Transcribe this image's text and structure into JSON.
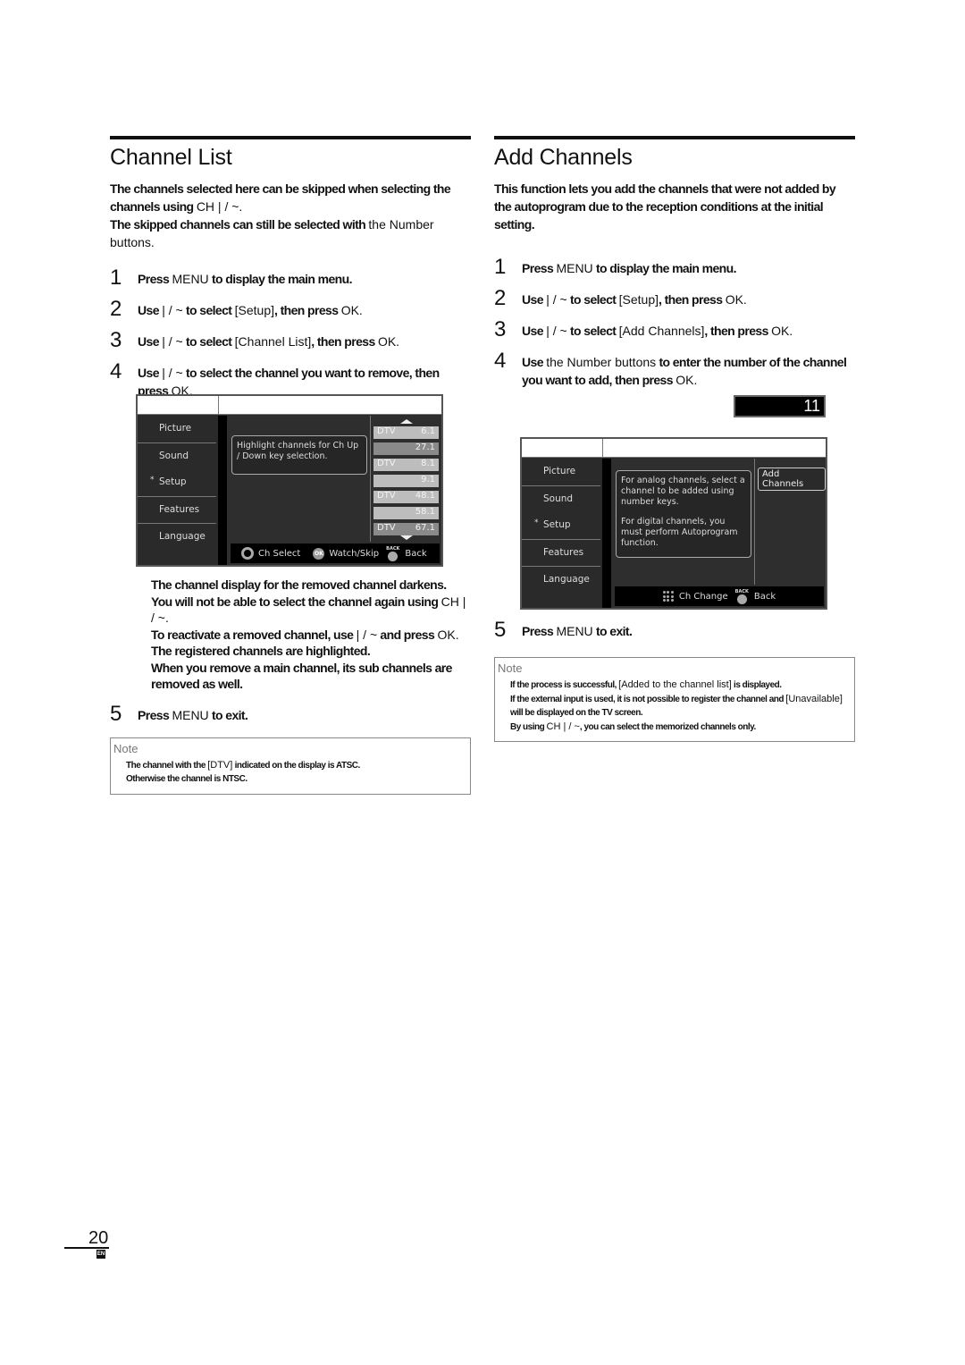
{
  "channel_list": {
    "title": "Channel List",
    "intro": [
      {
        "bold": "The channels selected here can be skipped when selecting the channels using ",
        "plain": "CH  | / ~."
      },
      {
        "bold": "The skipped channels can still be selected with ",
        "plain": "the Number buttons."
      }
    ],
    "steps": [
      {
        "num": "1",
        "parts": [
          {
            "b": "Press "
          },
          {
            "p": "MENU"
          },
          {
            "b": " to display the main menu."
          }
        ]
      },
      {
        "num": "2",
        "parts": [
          {
            "b": "Use  "
          },
          {
            "p": "| / ~"
          },
          {
            "b": " to select "
          },
          {
            "p": "[Setup]"
          },
          {
            "b": ", then press "
          },
          {
            "p": "OK."
          }
        ]
      },
      {
        "num": "3",
        "parts": [
          {
            "b": "Use  "
          },
          {
            "p": "| / ~"
          },
          {
            "b": " to select "
          },
          {
            "p": "[Channel List]"
          },
          {
            "b": ", then press "
          },
          {
            "p": "OK."
          }
        ]
      },
      {
        "num": "4",
        "parts": [
          {
            "b": "Use  "
          },
          {
            "p": "| / ~"
          },
          {
            "b": " to select the channel you want to remove, then press "
          },
          {
            "p": "OK."
          }
        ]
      }
    ],
    "osd": {
      "nav": [
        "Picture",
        "Sound",
        "Setup",
        "Features",
        "Language"
      ],
      "active_marker": "*",
      "message": "Highlight channels for Ch Up / Down key selection.",
      "channels": [
        {
          "type": "DTV",
          "number": "6.1",
          "shade": "light"
        },
        {
          "type": "",
          "number": "27.1",
          "shade": "dark"
        },
        {
          "type": "DTV",
          "number": "8.1",
          "shade": "light"
        },
        {
          "type": "",
          "number": "9.1",
          "shade": "light"
        },
        {
          "type": "DTV",
          "number": "48.1",
          "shade": "light"
        },
        {
          "type": "",
          "number": "58.1",
          "shade": "light"
        },
        {
          "type": "DTV",
          "number": "67.1",
          "shade": "dark"
        }
      ],
      "footer": {
        "select": "Ch Select",
        "ok_icon": "OK",
        "watch_skip": "Watch/Skip",
        "back_icon_label": "BACK",
        "back": "Back"
      }
    },
    "sub_notes": [
      {
        "parts": [
          {
            "b": "The channel display for the removed channel darkens."
          }
        ]
      },
      {
        "parts": [
          {
            "b": "You will not be able to select the channel again using "
          },
          {
            "p": "CH  | / ~."
          }
        ]
      },
      {
        "parts": [
          {
            "b": "To reactivate a removed channel, use  "
          },
          {
            "p": "| / ~"
          },
          {
            "b": " and press "
          },
          {
            "p": "OK."
          },
          {
            "b": " The registered channels are highlighted."
          }
        ]
      },
      {
        "parts": [
          {
            "b": "When you remove a main channel, its sub channels are removed as well."
          }
        ]
      }
    ],
    "step5": {
      "num": "5",
      "parts": [
        {
          "b": "Press "
        },
        {
          "p": "MENU"
        },
        {
          "b": " to exit."
        }
      ]
    },
    "note": {
      "title": "Note",
      "lines": [
        {
          "parts": [
            {
              "b": "The channel with the "
            },
            {
              "p": "[DTV]"
            },
            {
              "b": " indicated on the display is ATSC."
            }
          ]
        },
        {
          "parts": [
            {
              "b": "Otherwise the channel is NTSC."
            }
          ]
        }
      ]
    }
  },
  "add_channels": {
    "title": "Add Channels",
    "intro": [
      {
        "bold": "This function lets you add the channels that were not added by the autoprogram due to the reception conditions at the initial setting."
      }
    ],
    "steps": [
      {
        "num": "1",
        "parts": [
          {
            "b": "Press "
          },
          {
            "p": "MENU"
          },
          {
            "b": " to display the main menu."
          }
        ]
      },
      {
        "num": "2",
        "parts": [
          {
            "b": "Use  "
          },
          {
            "p": "| / ~"
          },
          {
            "b": " to select "
          },
          {
            "p": "[Setup]"
          },
          {
            "b": ", then press "
          },
          {
            "p": "OK."
          }
        ]
      },
      {
        "num": "3",
        "parts": [
          {
            "b": "Use  "
          },
          {
            "p": "| / ~"
          },
          {
            "b": " to select "
          },
          {
            "p": "[Add Channels]"
          },
          {
            "b": ", then press "
          },
          {
            "p": "OK."
          }
        ]
      },
      {
        "num": "4",
        "parts": [
          {
            "b": "Use "
          },
          {
            "p": "the Number buttons"
          },
          {
            "b": " to enter the number of the channel you want to add, then press "
          },
          {
            "p": "OK."
          }
        ]
      }
    ],
    "channel_display": "11",
    "osd": {
      "nav": [
        "Picture",
        "Sound",
        "Setup",
        "Features",
        "Language"
      ],
      "active_marker": "*",
      "message_1": "For analog channels, select a channel to be added using number keys.",
      "message_2": "For digital channels, you must perform Autoprogram function.",
      "button": "Add Channels",
      "footer": {
        "change": "Ch Change",
        "back_icon_label": "BACK",
        "back": "Back"
      }
    },
    "step5": {
      "num": "5",
      "parts": [
        {
          "b": "Press "
        },
        {
          "p": "MENU"
        },
        {
          "b": " to exit."
        }
      ]
    },
    "note": {
      "title": "Note",
      "lines": [
        {
          "parts": [
            {
              "b": "If the process is successful, "
            },
            {
              "p": "[Added to the channel list]"
            },
            {
              "b": " is displayed."
            }
          ]
        },
        {
          "parts": [
            {
              "b": "If the external input is used, it is not possible to register the channel and "
            },
            {
              "p": "[Unavailable]"
            },
            {
              "b": " will be displayed on the TV screen."
            }
          ]
        },
        {
          "parts": [
            {
              "b": "By using "
            },
            {
              "p": "CH  | / ~"
            },
            {
              "b": ", you can select the memorized channels only."
            }
          ]
        }
      ]
    }
  },
  "footer": {
    "page_number": "20",
    "language_tag": "EN"
  }
}
